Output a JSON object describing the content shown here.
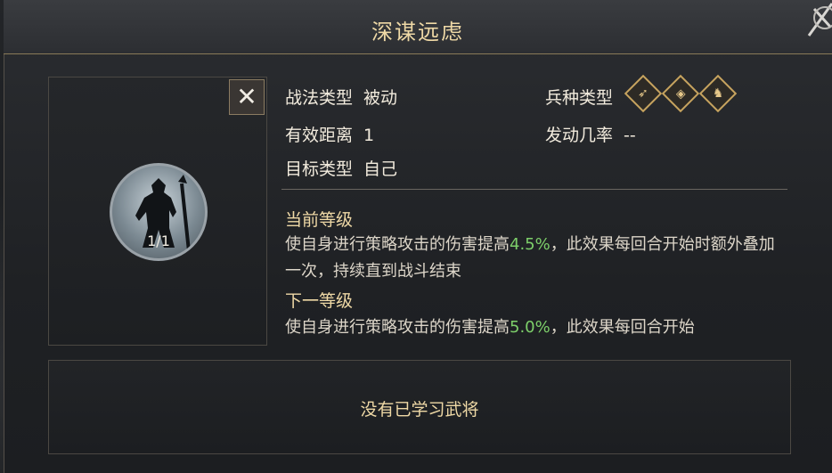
{
  "dialog": {
    "title": "深谋远虑",
    "close_symbol": "✕"
  },
  "portrait": {
    "count": "1/1",
    "close_symbol": "✕"
  },
  "info": {
    "tactic_type_label": "战法类型",
    "tactic_type_value": "被动",
    "range_label": "有效距离",
    "range_value": "1",
    "target_label": "目标类型",
    "target_value": "自己",
    "troop_type_label": "兵种类型",
    "trigger_rate_label": "发动几率",
    "trigger_rate_value": "--",
    "troop_icons": [
      "bow-icon",
      "shield-icon",
      "horse-icon"
    ]
  },
  "current_level": {
    "title": "当前等级",
    "desc_before": "使自身进行策略攻击的伤害提高",
    "value": "4.5%",
    "desc_after": "，此效果每回合开始时额外叠加一次，持续直到战斗结束"
  },
  "next_level": {
    "title": "下一等级",
    "desc_before": "使自身进行策略攻击的伤害提高",
    "value": "5.0%",
    "desc_after": "，此效果每回合开始"
  },
  "learn_box": {
    "text": "没有已学习武将"
  },
  "colors": {
    "title_gold": "#efd9a6",
    "highlight_green": "#7dcf6a"
  }
}
